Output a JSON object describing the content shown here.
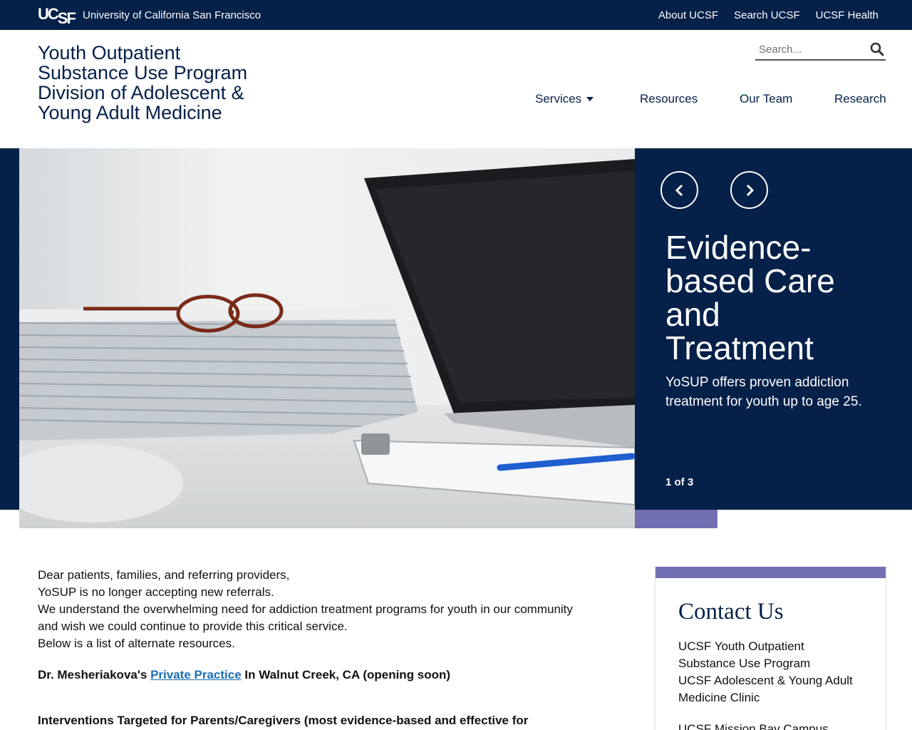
{
  "topbar": {
    "logo": "UCSF",
    "logo_uc": "UC",
    "logo_sf": "SF",
    "university": "University of California San Francisco",
    "links": [
      "About UCSF",
      "Search UCSF",
      "UCSF Health"
    ]
  },
  "header": {
    "title_lines": [
      "Youth Outpatient",
      "Substance Use Program",
      "Division of Adolescent &",
      "Young Adult Medicine"
    ],
    "search_placeholder": "Search...",
    "nav": [
      "Services",
      "Resources",
      "Our Team",
      "Research"
    ]
  },
  "hero": {
    "heading_lines": [
      "Evidence-",
      "based Care",
      "and",
      "Treatment"
    ],
    "subtitle": "YoSUP offers proven addiction treatment for youth up to age 25.",
    "counter": "1 of 3"
  },
  "main": {
    "paragraphs": [
      "Dear patients, families, and referring providers,",
      "YoSUP is no longer accepting new referrals.",
      "We understand the overwhelming need for addiction treatment programs for youth in our community and wish we could continue to provide this critical service.",
      "Below is a list of alternate resources."
    ],
    "practice_prefix": "Dr. Mesheriakova's ",
    "practice_link": "Private Practice",
    "practice_suffix": " In Walnut Creek, CA (opening soon)",
    "interventions_heading": "Interventions Targeted for Parents/Caregivers (most evidence-based and effective for"
  },
  "contact": {
    "title": "Contact Us",
    "lines": [
      "UCSF Youth Outpatient",
      "Substance Use Program",
      "UCSF Adolescent & Young Adult",
      "Medicine Clinic"
    ],
    "next_line": "UCSF Mission Bay Campus"
  },
  "colors": {
    "navy": "#052049",
    "accent_purple": "#716fb2",
    "link_blue": "#1a6eb5"
  }
}
